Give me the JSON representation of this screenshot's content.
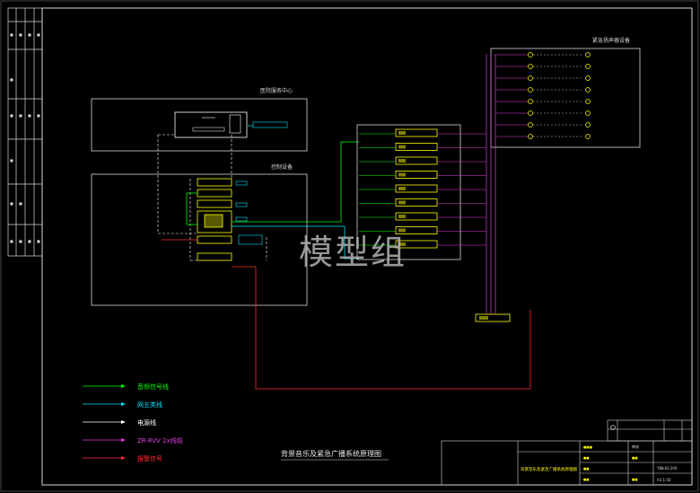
{
  "drawing": {
    "title": "背景音乐及紧急广播系统原理图",
    "watermark": "模型组",
    "sections": {
      "service_center": "医院服务中心",
      "control_equipment": "控制设备",
      "speakers": "紧急扬声器设备"
    },
    "legend": [
      {
        "key": "audio",
        "label": "音频信号线",
        "color": "#00ff00"
      },
      {
        "key": "bus",
        "label": "网五类线",
        "color": "#00e5ff"
      },
      {
        "key": "power",
        "label": "电源线",
        "color": "#ffffff"
      },
      {
        "key": "rvv",
        "label": "ZR-RVV 2x线缆",
        "color": "#e040e0"
      },
      {
        "key": "alarm",
        "label": "报警信号",
        "color": "#ff2a2a"
      }
    ],
    "colors": {
      "frame": "#d8d8d8",
      "device": "#ffff00",
      "audio": "#00ff00",
      "bus": "#00e5ff",
      "rvv": "#e040e0",
      "alarm": "#ff2a2a",
      "power": "#ffffff"
    },
    "title_block": {
      "project_name": "背景音乐及紧急广播系统原理图",
      "drawing_no": "Y88-ID-200",
      "scale": "A3 1:50",
      "top_right_header": "审核"
    }
  }
}
